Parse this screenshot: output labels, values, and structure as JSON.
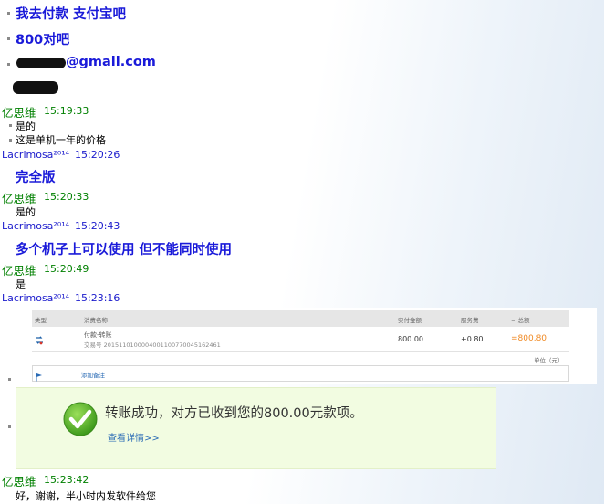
{
  "chat": {
    "line1": "我去付款 支付宝吧",
    "line2": "800对吧",
    "line3_suffix": "@gmail.com",
    "users": {
      "yisiwei": "亿思维",
      "lacrimosa": "Lacrimosa²⁰¹⁴"
    },
    "t1": "15:19:33",
    "m1a": "是的",
    "m1b": "这是单机一年的价格",
    "t2": "15:20:26",
    "m2": "完全版",
    "t3": "15:20:33",
    "m3": "是的",
    "t4": "15:20:43",
    "m4": "多个机子上可以使用 但不能同时使用",
    "t5": "15:20:49",
    "m5": "是",
    "t6": "15:23:16",
    "t7": "15:23:42",
    "m7": "好，谢谢，半小时内发软件给您"
  },
  "payment": {
    "headers": {
      "type": "类型",
      "name": "消费名称",
      "paid": "实付金额",
      "fee": "服务费",
      "total": "= 总额"
    },
    "row": {
      "title": "付款-转账",
      "serial": "交易号 2015110100004001100770045162461",
      "paid": "800.00",
      "fee": "+0.80",
      "total": "=800.80"
    },
    "unit": "单位（元）",
    "add_note": "添加备注"
  },
  "success": {
    "message": "转账成功，对方已收到您的800.00元款项。",
    "link": "查看详情>>"
  },
  "colors": {
    "blue_text": "#1a1ad9",
    "green_name": "#008000",
    "success_bg": "#f2fce1",
    "total_orange": "#f08a24"
  }
}
